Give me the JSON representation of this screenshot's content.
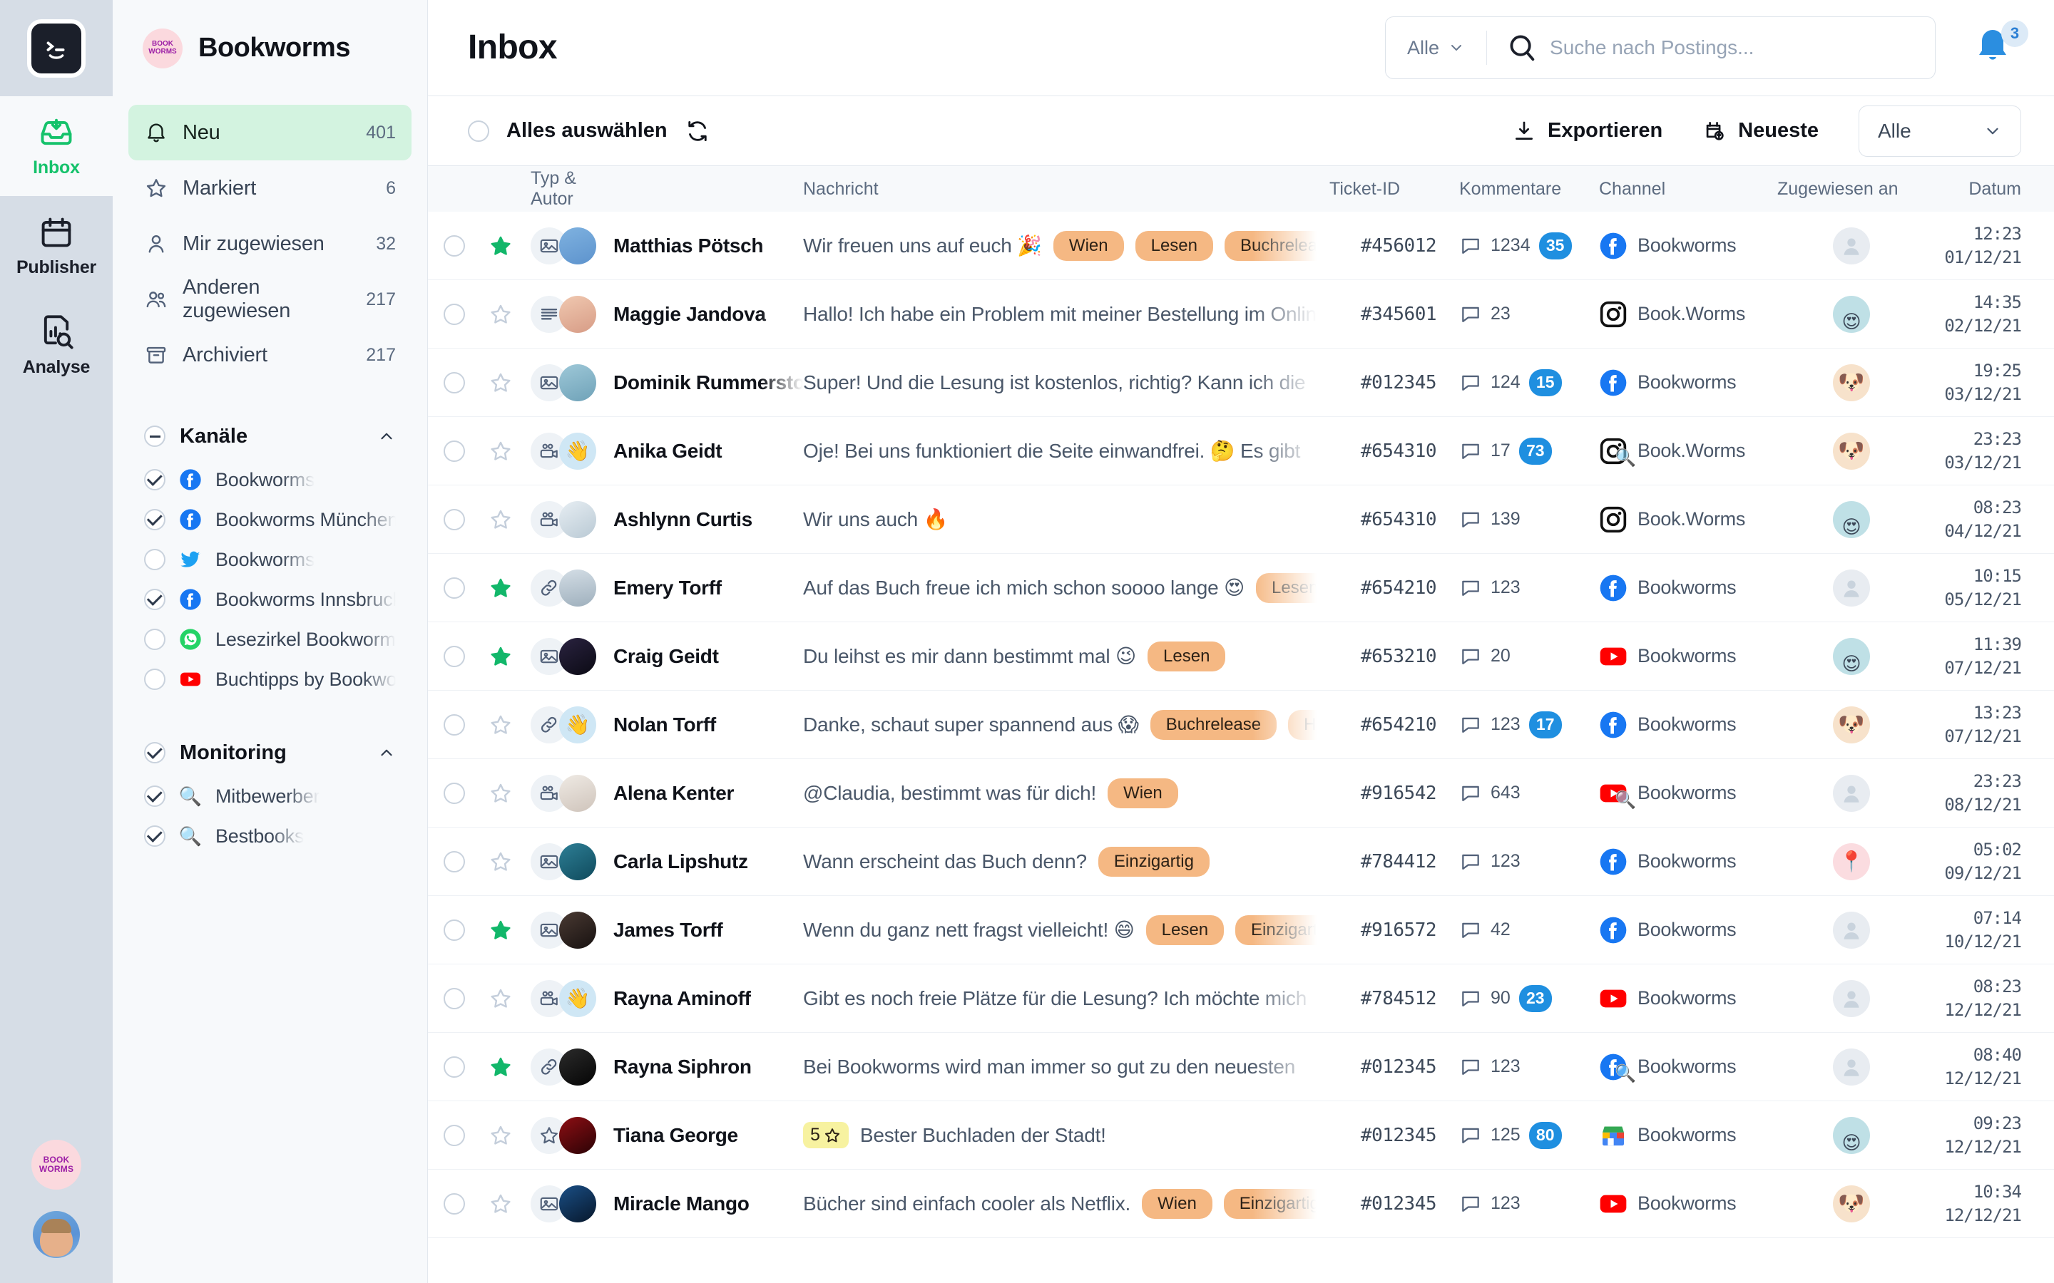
{
  "rail": {
    "logo_icon": "app-logo-icon",
    "items": [
      {
        "label": "Inbox",
        "icon": "inbox-icon",
        "active": true
      },
      {
        "label": "Publisher",
        "icon": "calendar-icon",
        "active": false
      },
      {
        "label": "Analyse",
        "icon": "analytics-icon",
        "active": false
      }
    ],
    "brand_logo_text": "BOOK WORMS",
    "user_avatar": "user-avatar"
  },
  "sidebar": {
    "brand": "Bookworms",
    "nav": [
      {
        "label": "Neu",
        "count": "401",
        "icon": "bell-icon",
        "active": true
      },
      {
        "label": "Markiert",
        "count": "6",
        "icon": "star-icon",
        "active": false
      },
      {
        "label": "Mir zugewiesen",
        "count": "32",
        "icon": "person-icon",
        "active": false
      },
      {
        "label": "Anderen zugewiesen",
        "count": "217",
        "icon": "people-icon",
        "active": false
      },
      {
        "label": "Archiviert",
        "count": "217",
        "icon": "archive-icon",
        "active": false
      }
    ],
    "groups": [
      {
        "label": "Kanäle",
        "check_state": "dash",
        "items": [
          {
            "label": "Bookworms",
            "network": "facebook",
            "checked": true
          },
          {
            "label": "Bookworms München",
            "network": "facebook",
            "checked": true
          },
          {
            "label": "Bookworms",
            "network": "twitter",
            "checked": false
          },
          {
            "label": "Bookworms Innsbruck",
            "network": "facebook",
            "checked": true
          },
          {
            "label": "Lesezirkel Bookworms",
            "network": "whatsapp",
            "checked": false
          },
          {
            "label": "Buchtipps by Bookworms",
            "network": "youtube",
            "checked": false
          }
        ]
      },
      {
        "label": "Monitoring",
        "check_state": "checked",
        "items": [
          {
            "label": "Mitbewerber",
            "network": "search",
            "checked": true
          },
          {
            "label": "Bestbooks",
            "network": "search",
            "checked": true
          }
        ]
      }
    ]
  },
  "topbar": {
    "title": "Inbox",
    "search_scope": "Alle",
    "search_placeholder": "Suche nach Postings...",
    "search_value": "",
    "notification_count": "3"
  },
  "actionbar": {
    "select_all": "Alles auswählen",
    "refresh_icon": "refresh-icon",
    "export": "Exportieren",
    "sort": "Neueste",
    "filter_value": "Alle"
  },
  "table": {
    "columns": [
      "Typ & Autor",
      "Nachricht",
      "Ticket-ID",
      "Kommentare",
      "Channel",
      "Zugewiesen an",
      "Datum"
    ],
    "rows": [
      {
        "starred": true,
        "type": "image",
        "avatar": "av-m1",
        "avatar_emoji": "",
        "name": "Matthias Pötsch",
        "message": "Wir freuen uns auf euch 🎉",
        "tags": [
          "Wien",
          "Lesen",
          "Buchrelease"
        ],
        "rating": "",
        "ticket": "#456012",
        "comments": "1234",
        "badge": "35",
        "channel": "Bookworms",
        "network": "facebook",
        "monitor": false,
        "assigned": "none",
        "time": "12:23",
        "date": "01/12/21"
      },
      {
        "starred": false,
        "type": "text",
        "avatar": "av-f1",
        "avatar_emoji": "",
        "name": "Maggie Jandova",
        "message": "Hallo! Ich habe ein Problem mit meiner Bestellung im Onlineshop",
        "tags": [],
        "rating": "",
        "ticket": "#345601",
        "comments": "23",
        "badge": "",
        "channel": "Book.Worms",
        "network": "instagram",
        "monitor": false,
        "assigned": "av-girl",
        "time": "14:35",
        "date": "02/12/21"
      },
      {
        "starred": false,
        "type": "image",
        "avatar": "av-m2",
        "avatar_emoji": "",
        "name": "Dominik Rummerstorfer",
        "message": "Super! Und die Lesung ist kostenlos, richtig? Kann ich die",
        "tags": [],
        "rating": "",
        "ticket": "#012345",
        "comments": "124",
        "badge": "15",
        "channel": "Bookworms",
        "network": "facebook",
        "monitor": false,
        "assigned": "av-dog",
        "time": "19:25",
        "date": "03/12/21"
      },
      {
        "starred": false,
        "type": "video",
        "avatar": "av-wave",
        "avatar_emoji": "👋",
        "name": "Anika Geidt",
        "message": "Oje! Bei uns funktioniert die Seite einwandfrei. 🤔 Es gibt",
        "tags": [],
        "rating": "",
        "ticket": "#654310",
        "comments": "17",
        "badge": "73",
        "channel": "Book.Worms",
        "network": "instagram",
        "monitor": true,
        "assigned": "av-dog",
        "time": "23:23",
        "date": "03/12/21"
      },
      {
        "starred": false,
        "type": "video",
        "avatar": "av-snow",
        "avatar_emoji": "",
        "name": "Ashlynn Curtis",
        "message": "Wir uns auch 🔥",
        "tags": [],
        "rating": "",
        "ticket": "#654310",
        "comments": "139",
        "badge": "",
        "channel": "Book.Worms",
        "network": "instagram",
        "monitor": false,
        "assigned": "av-girl",
        "time": "08:23",
        "date": "04/12/21"
      },
      {
        "starred": true,
        "type": "link",
        "avatar": "av-sky",
        "avatar_emoji": "",
        "name": "Emery Torff",
        "message": "Auf das Buch freue ich mich schon soooo lange 😍",
        "tags": [
          "Lesen"
        ],
        "rating": "",
        "ticket": "#654210",
        "comments": "123",
        "badge": "",
        "channel": "Bookworms",
        "network": "facebook",
        "monitor": false,
        "assigned": "none",
        "time": "10:15",
        "date": "05/12/21"
      },
      {
        "starred": true,
        "type": "image",
        "avatar": "av-night",
        "avatar_emoji": "",
        "name": "Craig Geidt",
        "message": "Du leihst es mir dann bestimmt mal 😉",
        "tags": [
          "Lesen"
        ],
        "rating": "",
        "ticket": "#653210",
        "comments": "20",
        "badge": "",
        "channel": "Bookworms",
        "network": "youtube",
        "monitor": false,
        "assigned": "av-girl",
        "time": "11:39",
        "date": "07/12/21"
      },
      {
        "starred": false,
        "type": "link",
        "avatar": "av-wave",
        "avatar_emoji": "👋",
        "name": "Nolan Torff",
        "message": "Danke, schaut super spannend aus 😱",
        "tags": [
          "Buchrelease",
          "Hardcover"
        ],
        "rating": "",
        "ticket": "#654210",
        "comments": "123",
        "badge": "17",
        "channel": "Bookworms",
        "network": "facebook",
        "monitor": false,
        "assigned": "av-dog",
        "time": "13:23",
        "date": "07/12/21"
      },
      {
        "starred": false,
        "type": "video",
        "avatar": "av-sand",
        "avatar_emoji": "",
        "name": "Alena Kenter",
        "message": "@Claudia, bestimmt was für dich!",
        "tags": [
          "Wien"
        ],
        "rating": "",
        "ticket": "#916542",
        "comments": "643",
        "badge": "",
        "channel": "Bookworms",
        "network": "youtube",
        "monitor": true,
        "assigned": "none",
        "time": "23:23",
        "date": "08/12/21"
      },
      {
        "starred": false,
        "type": "image",
        "avatar": "av-ocean",
        "avatar_emoji": "",
        "name": "Carla Lipshutz",
        "message": "Wann erscheint das Buch denn?",
        "tags": [
          "Einzigartig"
        ],
        "rating": "",
        "ticket": "#784412",
        "comments": "123",
        "badge": "",
        "channel": "Bookworms",
        "network": "facebook",
        "monitor": false,
        "assigned": "av-pinkdot",
        "time": "05:02",
        "date": "09/12/21"
      },
      {
        "starred": true,
        "type": "image",
        "avatar": "av-smoke",
        "avatar_emoji": "",
        "name": "James Torff",
        "message": "Wenn du ganz nett fragst vielleicht! 😄",
        "tags": [
          "Lesen",
          "Einzigartig"
        ],
        "rating": "",
        "ticket": "#916572",
        "comments": "42",
        "badge": "",
        "channel": "Bookworms",
        "network": "facebook",
        "monitor": false,
        "assigned": "none",
        "time": "07:14",
        "date": "10/12/21"
      },
      {
        "starred": false,
        "type": "video",
        "avatar": "av-wave",
        "avatar_emoji": "👋",
        "name": "Rayna Aminoff",
        "message": "Gibt es noch freie Plätze für die Lesung? Ich möchte mich",
        "tags": [],
        "rating": "",
        "ticket": "#784512",
        "comments": "90",
        "badge": "23",
        "channel": "Bookworms",
        "network": "youtube",
        "monitor": false,
        "assigned": "none",
        "time": "08:23",
        "date": "12/12/21"
      },
      {
        "starred": true,
        "type": "link",
        "avatar": "av-dark",
        "avatar_emoji": "",
        "name": "Rayna Siphron",
        "message": "Bei Bookworms wird man immer so gut zu den neuesten",
        "tags": [],
        "rating": "",
        "ticket": "#012345",
        "comments": "123",
        "badge": "",
        "channel": "Bookworms",
        "network": "facebook",
        "monitor": true,
        "assigned": "none",
        "time": "08:40",
        "date": "12/12/21"
      },
      {
        "starred": false,
        "type": "review",
        "avatar": "av-red",
        "avatar_emoji": "",
        "name": "Tiana George",
        "message": "Bester Buchladen der Stadt!",
        "tags": [],
        "rating": "5",
        "ticket": "#012345",
        "comments": "125",
        "badge": "80",
        "channel": "Bookworms",
        "network": "gmb",
        "monitor": false,
        "assigned": "av-girl",
        "time": "09:23",
        "date": "12/12/21"
      },
      {
        "starred": false,
        "type": "image",
        "avatar": "av-blue",
        "avatar_emoji": "",
        "name": "Miracle Mango",
        "message": "Bücher sind einfach cooler als Netflix.",
        "tags": [
          "Wien",
          "Einzigartig"
        ],
        "rating": "",
        "ticket": "#012345",
        "comments": "123",
        "badge": "",
        "channel": "Bookworms",
        "network": "youtube",
        "monitor": false,
        "assigned": "av-dog",
        "time": "10:34",
        "date": "12/12/21"
      }
    ]
  },
  "colors": {
    "accent_green": "#15c26b",
    "highlight_green": "#d3f3e0",
    "tag_orange": "#f5b883",
    "badge_blue": "#1f8fe0",
    "rail_bg": "#d6dde6",
    "sidebar_bg": "#f7f9fb"
  }
}
